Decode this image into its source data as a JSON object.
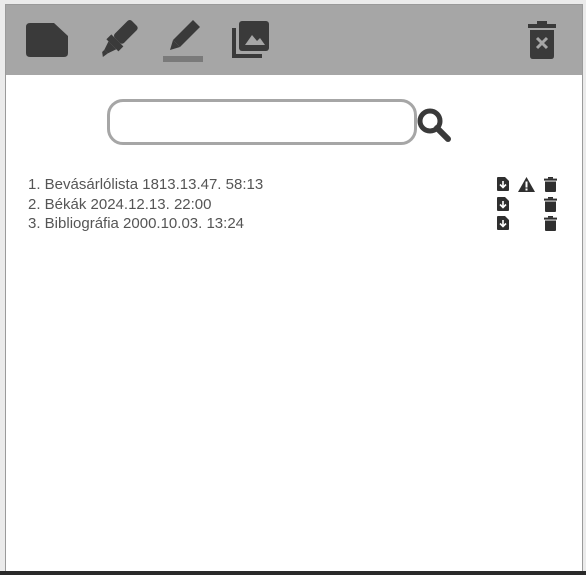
{
  "toolbar": {
    "buttons": [
      {
        "name": "new-note-button",
        "icon": "note-icon"
      },
      {
        "name": "highlighter-button",
        "icon": "highlighter-icon"
      },
      {
        "name": "pen-button",
        "icon": "pen-icon"
      },
      {
        "name": "gallery-button",
        "icon": "gallery-icon"
      },
      {
        "name": "delete-all-button",
        "icon": "trash-x-icon"
      }
    ],
    "background": "#a6a6a6",
    "icon_color": "#3a3a3a"
  },
  "search": {
    "value": "",
    "placeholder": ""
  },
  "notes": [
    {
      "label": "1. Bevásárlólista 1813.13.47. 58:13",
      "warning": true
    },
    {
      "label": "2. Békák 2024.12.13. 22:00",
      "warning": false
    },
    {
      "label": "3. Bibliográfia 2000.10.03. 13:24",
      "warning": false
    }
  ],
  "colors": {
    "text": "#555555",
    "icon": "#2f2f2f",
    "border": "#a6a6a6"
  }
}
